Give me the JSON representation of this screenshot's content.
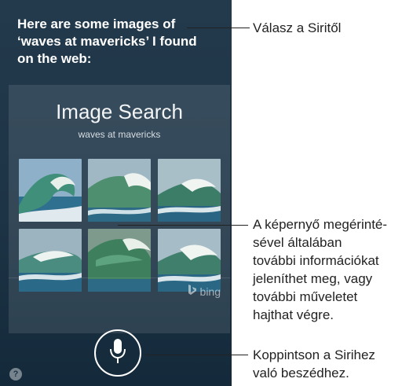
{
  "siri": {
    "response": "Here are some images of\n‘waves at mavericks’ I found\non the web:"
  },
  "card": {
    "title": "Image Search",
    "query": "waves at mavericks",
    "attribution": "bing",
    "thumbnails": [
      {
        "name": "wave-image-1"
      },
      {
        "name": "wave-image-2"
      },
      {
        "name": "wave-image-3"
      },
      {
        "name": "wave-image-4"
      },
      {
        "name": "wave-image-5"
      },
      {
        "name": "wave-image-6"
      }
    ]
  },
  "controls": {
    "mic_icon": "microphone-icon",
    "help_label": "?"
  },
  "callouts": [
    {
      "text": "Válasz a Siritől"
    },
    {
      "text": "A képernyő megérinté-\nsével általában\ntovábbi információkat\njeleníthet meg, vagy\ntovábbi műveletet\nhajthat végre."
    },
    {
      "text": "Koppintson a Sirihez\nvaló beszédhez."
    }
  ],
  "colors": {
    "siri_background": "#1d3446",
    "callout_text": "#222222"
  }
}
